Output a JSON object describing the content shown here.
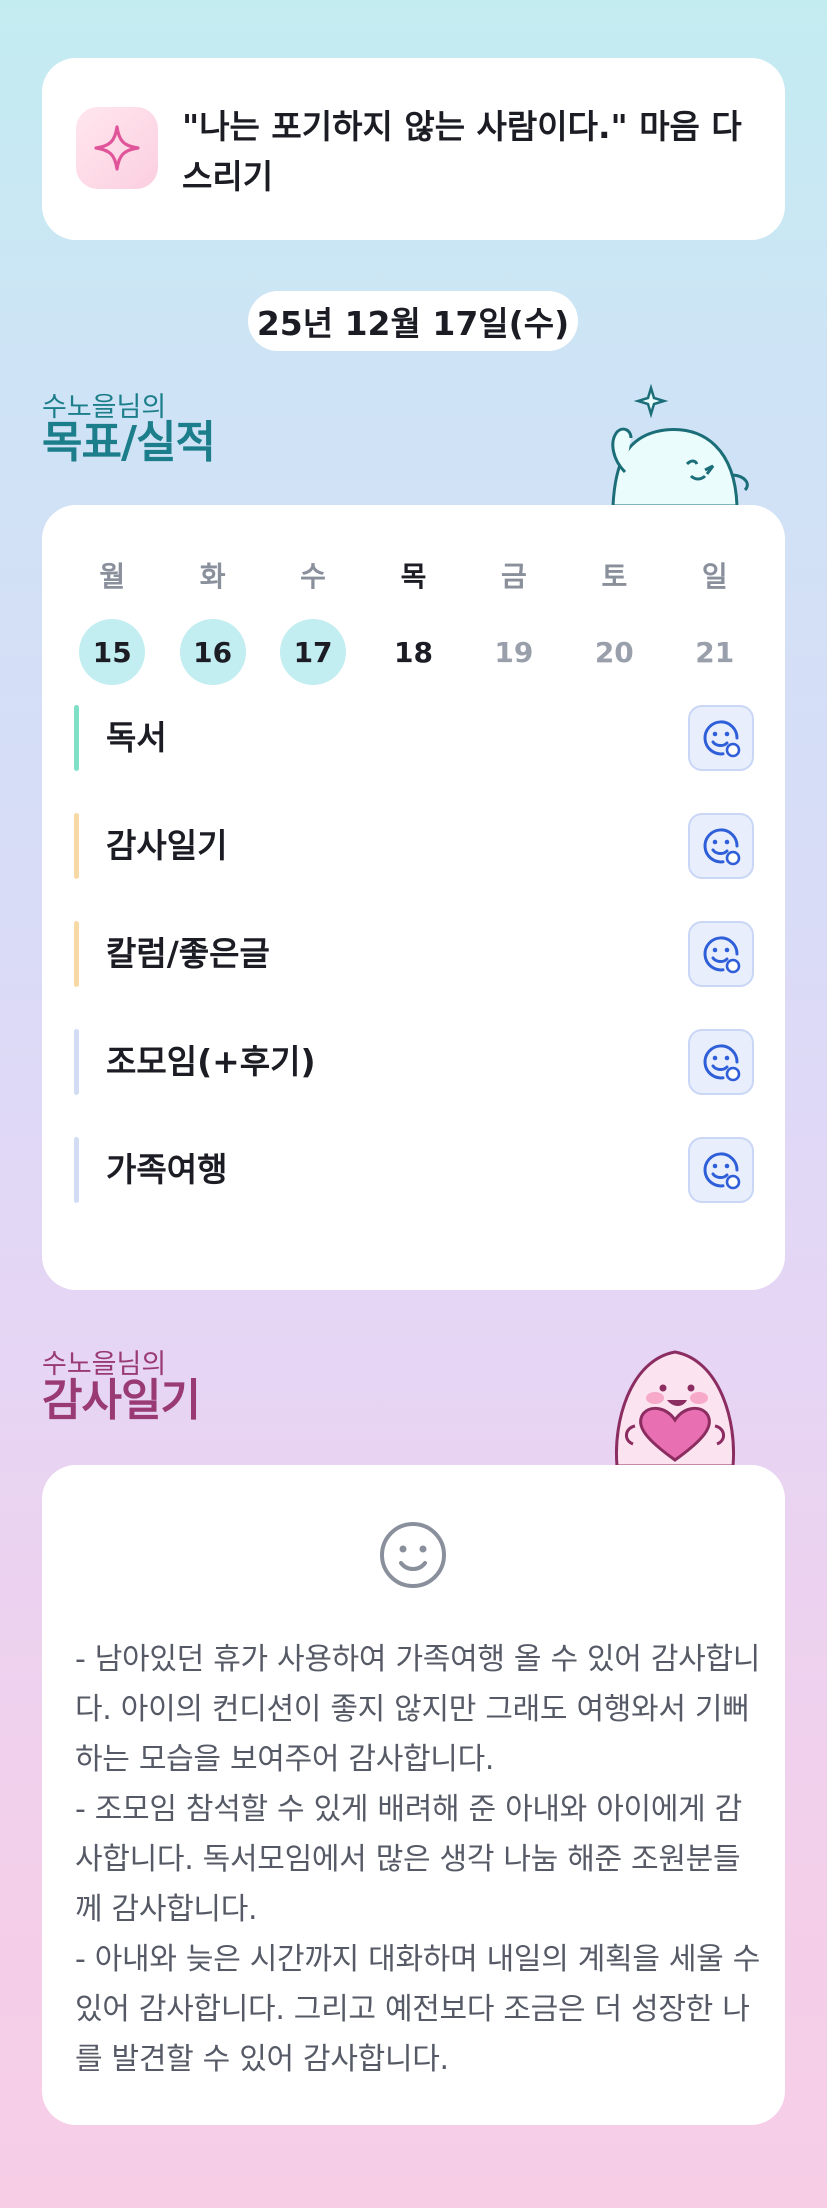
{
  "motto": {
    "icon": "sparkle-icon",
    "text": "\"나는 포기하지 않는 사람이다.\" 마음 다스리기"
  },
  "date": "25년 12월 17일(수)",
  "goals_section": {
    "subtitle": "수노을님의",
    "title": "목표/실적",
    "week": [
      {
        "name": "월",
        "num": "15",
        "state": "done"
      },
      {
        "name": "화",
        "num": "16",
        "state": "done"
      },
      {
        "name": "수",
        "num": "17",
        "state": "done"
      },
      {
        "name": "목",
        "num": "18",
        "state": "today"
      },
      {
        "name": "금",
        "num": "19",
        "state": "future"
      },
      {
        "name": "토",
        "num": "20",
        "state": "future"
      },
      {
        "name": "일",
        "num": "21",
        "state": "future"
      }
    ],
    "goals": [
      {
        "label": "독서",
        "color": "#7fe0c8"
      },
      {
        "label": "감사일기",
        "color": "#f7d9a6"
      },
      {
        "label": "칼럼/좋은글",
        "color": "#f7d9a6"
      },
      {
        "label": "조모임(+후기)",
        "color": "#d3dcf5"
      },
      {
        "label": "가족여행",
        "color": "#d3dcf5"
      }
    ],
    "goal_button_icon": "smiley-add-icon"
  },
  "gratitude_section": {
    "subtitle": "수노을님의",
    "title": "감사일기",
    "face_icon": "smiley-icon",
    "text": "- 남아있던 휴가 사용하여 가족여행 올 수 있어 감사합니다. 아이의 컨디션이 좋지 않지만 그래도 여행와서 기뻐하는 모습을 보여주어 감사합니다.\n- 조모임 참석할 수 있게 배려해 준 아내와 아이에게 감사합니다. 독서모임에서 많은 생각 나눔 해준 조원분들께 감사합니다.\n- 아내와 늦은 시간까지 대화하며 내일의 계획을 세울 수 있어 감사합니다. 그리고 예전보다 조금은 더 성장한 나를 발견할 수 있어 감사합니다."
  },
  "colors": {
    "goals_accent": "#1b7e8a",
    "gratitude_accent": "#9a3a74",
    "done_circle": "#c2edf1",
    "goal_button": "#e8eefc",
    "goal_icon": "#2f5fd8"
  }
}
